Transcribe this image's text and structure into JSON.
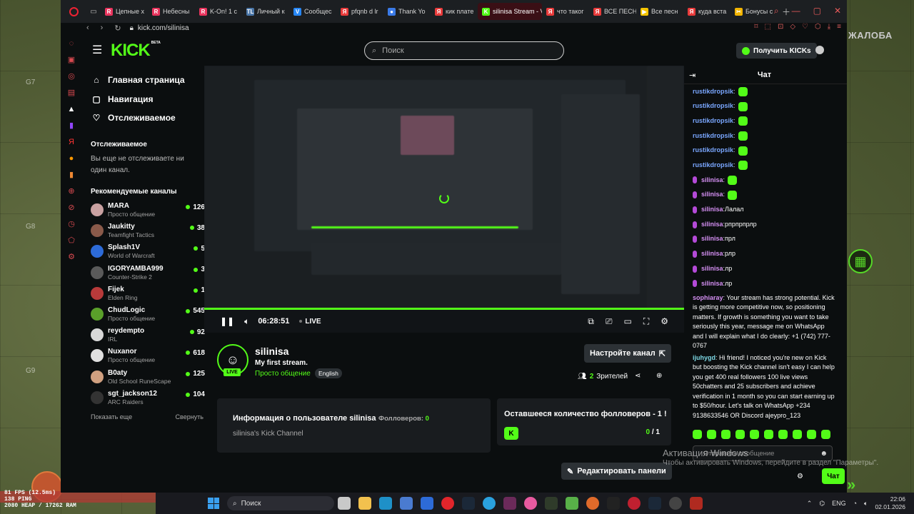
{
  "game": {
    "report_label": "ЖАЛОБА",
    "grid": [
      "G7",
      "G8",
      "G9"
    ],
    "hud": [
      "81 FPS (12.5ms)",
      "138 PING",
      "2080 HEAP / 17262 RAM"
    ]
  },
  "browser": {
    "tabs": [
      {
        "label": "Цепные х",
        "color": "#e8345d",
        "glyph": "R"
      },
      {
        "label": "Небесны",
        "color": "#e8345d",
        "glyph": "R"
      },
      {
        "label": "K-On! 1 с",
        "color": "#e8345d",
        "glyph": "R"
      },
      {
        "label": "Личный к",
        "color": "#4a76a8",
        "glyph": "TL"
      },
      {
        "label": "Сообщес",
        "color": "#2787f5",
        "glyph": "V"
      },
      {
        "label": "pfqnb d lr",
        "color": "#e83b3b",
        "glyph": "Я"
      },
      {
        "label": "Thank Yo",
        "color": "#3b7be8",
        "glyph": "●"
      },
      {
        "label": "кик плате",
        "color": "#e83b3b",
        "glyph": "Я"
      },
      {
        "label": "silinisa Stream - V",
        "color": "#53fc18",
        "glyph": "K",
        "active": true
      },
      {
        "label": "что таког",
        "color": "#e83b3b",
        "glyph": "Я"
      },
      {
        "label": "ВСЕ ПЕСН",
        "color": "#e83b3b",
        "glyph": "Я"
      },
      {
        "label": "Все песн",
        "color": "#f5c400",
        "glyph": "▶"
      },
      {
        "label": "куда вста",
        "color": "#e83b3b",
        "glyph": "Я"
      },
      {
        "label": "Бонусы с",
        "color": "#f2b400",
        "glyph": "✂"
      }
    ],
    "url": "kick.com/silinisa"
  },
  "header": {
    "logo": "KICK",
    "logo_beta": "BETA",
    "search_placeholder": "Поиск",
    "get_kicks": "Получить KICKs"
  },
  "sidebar": {
    "nav": [
      {
        "label": "Главная страница",
        "icon": "home-icon",
        "glyph": "⌂"
      },
      {
        "label": "Навигация",
        "icon": "browse-icon",
        "glyph": "▢"
      },
      {
        "label": "Отслеживаемое",
        "icon": "heart-icon",
        "glyph": "♡"
      }
    ],
    "following_header": "Отслеживаемое",
    "following_empty": "Вы еще не отслеживаете ни один канал.",
    "recommended_header": "Рекомендуемые каналы",
    "channels": [
      {
        "name": "MARA",
        "category": "Просто общение",
        "viewers": "126",
        "color": "#c9a1a1"
      },
      {
        "name": "Jaukitty",
        "category": "Teamfight Tactics",
        "viewers": "38",
        "color": "#8a5a4a"
      },
      {
        "name": "Splash1V",
        "category": "World of Warcraft",
        "viewers": "5",
        "color": "#2d6bd8"
      },
      {
        "name": "IGORYAMBA999",
        "category": "Counter-Strike 2",
        "viewers": "3",
        "color": "#5a5a5a"
      },
      {
        "name": "Fijek",
        "category": "Elden Ring",
        "viewers": "1",
        "color": "#b83a3a"
      },
      {
        "name": "ChudLogic",
        "category": "Просто общение",
        "viewers": "545",
        "color": "#5aa02a"
      },
      {
        "name": "reydempto",
        "category": "IRL",
        "viewers": "92",
        "color": "#d8d8d8"
      },
      {
        "name": "Nuxanor",
        "category": "Просто общение",
        "viewers": "618",
        "color": "#e0e0e0"
      },
      {
        "name": "B0aty",
        "category": "Old School RuneScape",
        "viewers": "125",
        "color": "#d0a080"
      },
      {
        "name": "sgt_jackson12",
        "category": "ARC Raiders",
        "viewers": "104",
        "color": "#333"
      }
    ],
    "show_more": "Показать еще",
    "collapse": "Свернуть"
  },
  "player": {
    "time": "06:28:51",
    "live": "LIVE",
    "progress": 1.0
  },
  "channel": {
    "name": "silinisa",
    "title": "My first stream.",
    "category": "Просто общение",
    "language": "English",
    "live_badge": "LIVE",
    "setup_button": "Настройте канал",
    "viewers_count": "2",
    "viewers_label": "Зрителей"
  },
  "panels": {
    "about_title": "Информация о пользователе silinisa",
    "followers_label": "Фолловеров:",
    "followers_count": "0",
    "about_desc": "silinisa's Kick Channel",
    "goal_title": "Оставшееся количество фолловеров - 1 !",
    "goal_current": "0",
    "goal_total": " / 1",
    "edit_panels": "Редактировать панели"
  },
  "chat": {
    "title": "Чат",
    "messages": [
      {
        "user": "rustikdropsik",
        "text": "",
        "emote": true,
        "cls": "u-rk"
      },
      {
        "user": "rustikdropsik",
        "text": "",
        "emote": true,
        "cls": "u-rk"
      },
      {
        "user": "rustikdropsik",
        "text": "",
        "emote": true,
        "cls": "u-rk"
      },
      {
        "user": "rustikdropsik",
        "text": "",
        "emote": true,
        "cls": "u-rk"
      },
      {
        "user": "rustikdropsik",
        "text": "",
        "emote": true,
        "cls": "u-rk"
      },
      {
        "user": "rustikdropsik",
        "text": "",
        "emote": true,
        "cls": "u-rk"
      },
      {
        "user": "silinisa",
        "text": "",
        "emote": true,
        "cls": "u-si",
        "badge": true
      },
      {
        "user": "silinisa",
        "text": "",
        "emote": true,
        "cls": "u-si",
        "badge": true
      },
      {
        "user": "silinisa",
        "text": "Лалал",
        "cls": "u-si",
        "badge": true
      },
      {
        "user": "silinisa",
        "text": "рпрпрпрлр",
        "cls": "u-si",
        "badge": true
      },
      {
        "user": "silinisa",
        "text": "прл",
        "cls": "u-si",
        "badge": true
      },
      {
        "user": "silinisa",
        "text": "рлр",
        "cls": "u-si",
        "badge": true
      },
      {
        "user": "silinisa",
        "text": "лр",
        "cls": "u-si",
        "badge": true
      },
      {
        "user": "silinisa",
        "text": "лр",
        "cls": "u-si",
        "badge": true
      },
      {
        "user": "sophiaray",
        "text": "Your stream has strong potential. Kick is getting more competitive now, so positioning matters. If growth is something you want to take seriously this year, message me on WhatsApp and I will explain what I do clearly: +1 (742) 777-0767",
        "cls": "u-so",
        "long": true
      },
      {
        "user": "ijuhygd",
        "text": "Hi friend! I noticed you're new on Kick but boosting the Kick channel isn't easy I can help you get 400 real followers 100 live views 50chatters and 25 subscribers and achieve verification in 1 month so you can start earning up to $50/hour. Let's talk on WhatsApp +234 9138633546 OR Discord ajeypro_123",
        "cls": "u-ij",
        "long": true
      }
    ],
    "input_placeholder": "Отправить сообщение",
    "send": "Чат"
  },
  "windows": {
    "activation_title": "Активация Windows",
    "activation_sub": "Чтобы активировать Windows, перейдите в раздел \"Параметры\".",
    "search": "Поиск",
    "lang": "ENG",
    "time": "22:06",
    "date": "02.01.2026"
  }
}
